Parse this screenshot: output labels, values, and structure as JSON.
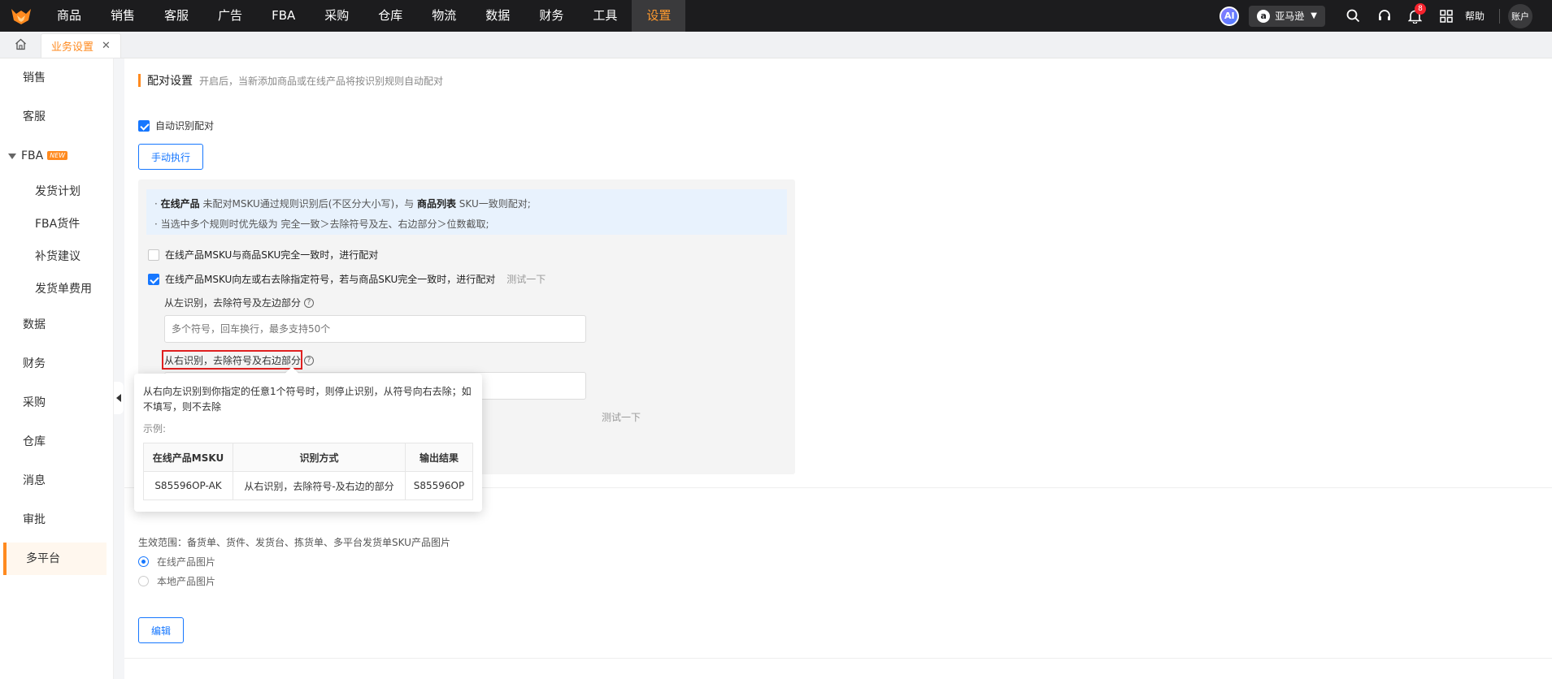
{
  "topnav": {
    "items": [
      "商品",
      "销售",
      "客服",
      "广告",
      "FBA",
      "采购",
      "仓库",
      "物流",
      "数据",
      "财务",
      "工具",
      "设置"
    ],
    "active_index": 11,
    "ai_label": "AI",
    "marketplace": "亚马逊",
    "notification_count": "8",
    "help_label": "帮助",
    "account_label": "账户"
  },
  "tabs": {
    "current": "业务设置"
  },
  "sidebar": {
    "items": [
      {
        "label": "销售"
      },
      {
        "label": "客服"
      },
      {
        "label": "FBA",
        "badge": "NEW",
        "sub": [
          "发货计划",
          "FBA货件",
          "补货建议",
          "发货单费用"
        ]
      },
      {
        "label": "数据"
      },
      {
        "label": "财务"
      },
      {
        "label": "采购"
      },
      {
        "label": "仓库"
      },
      {
        "label": "消息"
      },
      {
        "label": "审批"
      },
      {
        "label": "多平台"
      }
    ],
    "active": "多平台"
  },
  "match": {
    "title": "配对设置",
    "description": "开启后，当新添加商品或在线产品将按识别规则自动配对",
    "manual_button": "手动执行",
    "auto_label": "自动识别配对",
    "notice_line1_prefix": "· ",
    "notice_line1_b1": "在线产品",
    "notice_line1_mid": " 未配对MSKU通过规则识别后(不区分大小写)，与 ",
    "notice_line1_b2": "商品列表",
    "notice_line1_suffix": " SKU一致则配对;",
    "notice_line2": "· 当选中多个规则时优先级为 完全一致＞去除符号及左、右边部分＞位数截取;",
    "rule1": "在线产品MSKU与商品SKU完全一致时，进行配对",
    "rule2": "在线产品MSKU向左或右去除指定符号，若与商品SKU完全一致时，进行配对",
    "test_label": "测试一下",
    "left_label": "从左识别，去除符号及左边部分",
    "left_placeholder": "多个符号，回车换行，最多支持50个",
    "right_label": "从右识别，去除符号及右边部分",
    "hidden_test": "测试一下"
  },
  "image": {
    "scope": "生效范围：备货单、货件、发货台、拣货单、多平台发货单SKU产品图片",
    "options": [
      "在线产品图片",
      "本地产品图片"
    ],
    "selected": 0,
    "edit_button": "编辑"
  },
  "popover": {
    "text": "从右向左识别到你指定的任意1个符号时，则停止识别，从符号向右去除；如不填写，则不去除",
    "example_label": "示例:",
    "headers": [
      "在线产品MSKU",
      "识别方式",
      "输出结果"
    ],
    "row": [
      "S85596OP-AK",
      "从右识别，去除符号-及右边的部分",
      "S85596OP"
    ]
  },
  "colors": {
    "accent": "#ff8a1f",
    "primary": "#1677ff",
    "topbar": "#1c1c1e",
    "highlight": "#e02020"
  }
}
